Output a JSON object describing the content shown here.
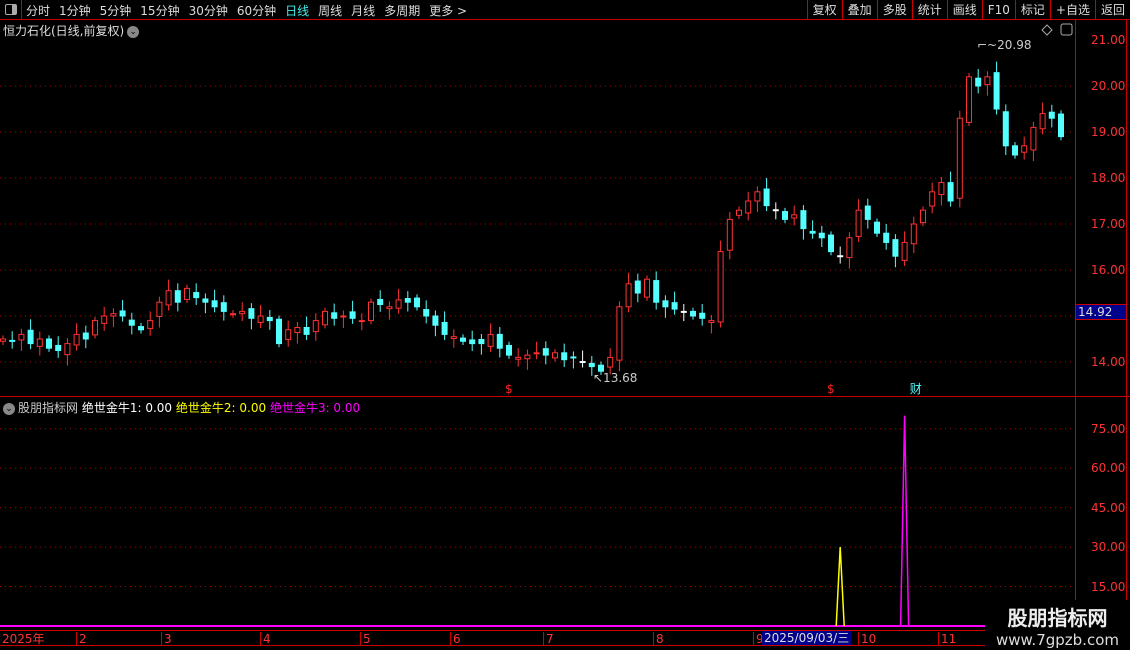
{
  "toolbar": {
    "periods": [
      "分时",
      "1分钟",
      "5分钟",
      "15分钟",
      "30分钟",
      "60分钟",
      "日线",
      "周线",
      "月线",
      "多周期",
      "更多 >"
    ],
    "active_period": "日线",
    "buttons": [
      "复权",
      "叠加",
      "多股",
      "统计",
      "画线",
      "F10",
      "标记",
      "+自选",
      "返回"
    ]
  },
  "chart": {
    "title": "恒力石化(日线,前复权)",
    "y_ticks": [
      "21.00",
      "20.00",
      "19.00",
      "18.00",
      "17.00",
      "16.00",
      "14.00"
    ],
    "current_price": "14.92",
    "high_label": "20.98",
    "low_label": "13.68",
    "colors": {
      "up": "#ff3232",
      "down": "#54ffff",
      "flat": "#ffffff"
    },
    "markers": [
      {
        "text": "$",
        "color": "#ff2020",
        "candle": 55
      },
      {
        "text": "$",
        "color": "#ff2020",
        "candle": 90
      },
      {
        "text": "财",
        "color": "#54ffff",
        "candle": 99
      }
    ],
    "closes": [
      14.5,
      14.45,
      14.6,
      14.4,
      14.5,
      14.3,
      14.25,
      14.4,
      14.6,
      14.5,
      14.9,
      15.0,
      15.05,
      15.0,
      14.8,
      14.7,
      14.9,
      15.3,
      15.55,
      15.3,
      15.6,
      15.4,
      15.3,
      15.2,
      15.1,
      15.05,
      15.1,
      14.95,
      15.0,
      14.9,
      14.4,
      14.7,
      14.75,
      14.6,
      14.9,
      15.1,
      14.95,
      15.0,
      14.95,
      14.9,
      15.3,
      15.25,
      15.2,
      15.35,
      15.3,
      15.2,
      15.0,
      14.8,
      14.6,
      14.55,
      14.45,
      14.4,
      14.4,
      14.6,
      14.3,
      14.15,
      14.1,
      14.15,
      14.2,
      14.15,
      14.2,
      14.05,
      14.1,
      14.0,
      13.9,
      13.8,
      14.1,
      15.2,
      15.7,
      15.5,
      15.8,
      15.3,
      15.2,
      15.15,
      15.1,
      15.0,
      14.95,
      14.9,
      16.4,
      17.1,
      17.3,
      17.5,
      17.7,
      17.4,
      17.3,
      17.1,
      17.2,
      16.9,
      16.8,
      16.7,
      16.4,
      16.3,
      16.7,
      17.3,
      17.1,
      16.8,
      16.6,
      16.3,
      16.6,
      17.0,
      17.3,
      17.7,
      17.9,
      17.5,
      19.3,
      20.2,
      20.0,
      20.2,
      19.5,
      18.7,
      18.5,
      18.7,
      19.1,
      19.4,
      19.3,
      18.9
    ]
  },
  "indicator": {
    "source": "股朋指标网",
    "items": [
      {
        "label": "绝世金牛1: 0.00",
        "color": "#ffffff"
      },
      {
        "label": "绝世金牛2: 0.00",
        "color": "#ffff00"
      },
      {
        "label": "绝世金牛3: 0.00",
        "color": "#ff00ff"
      }
    ],
    "y_ticks": [
      "75.00",
      "60.00",
      "45.00",
      "30.00",
      "15.00"
    ],
    "spikes": [
      {
        "series": 2,
        "candle": 91,
        "value": 30
      },
      {
        "series": 3,
        "candle": 98,
        "value": 80
      }
    ]
  },
  "xaxis": {
    "labels": [
      "2025年",
      "2",
      "3",
      "4",
      "5",
      "6",
      "7",
      "8",
      "9",
      "10",
      "11"
    ],
    "cursor_date": "2025/09/03/三"
  },
  "watermark": {
    "name": "股朋指标网",
    "url": "www.7gpzb.com"
  }
}
